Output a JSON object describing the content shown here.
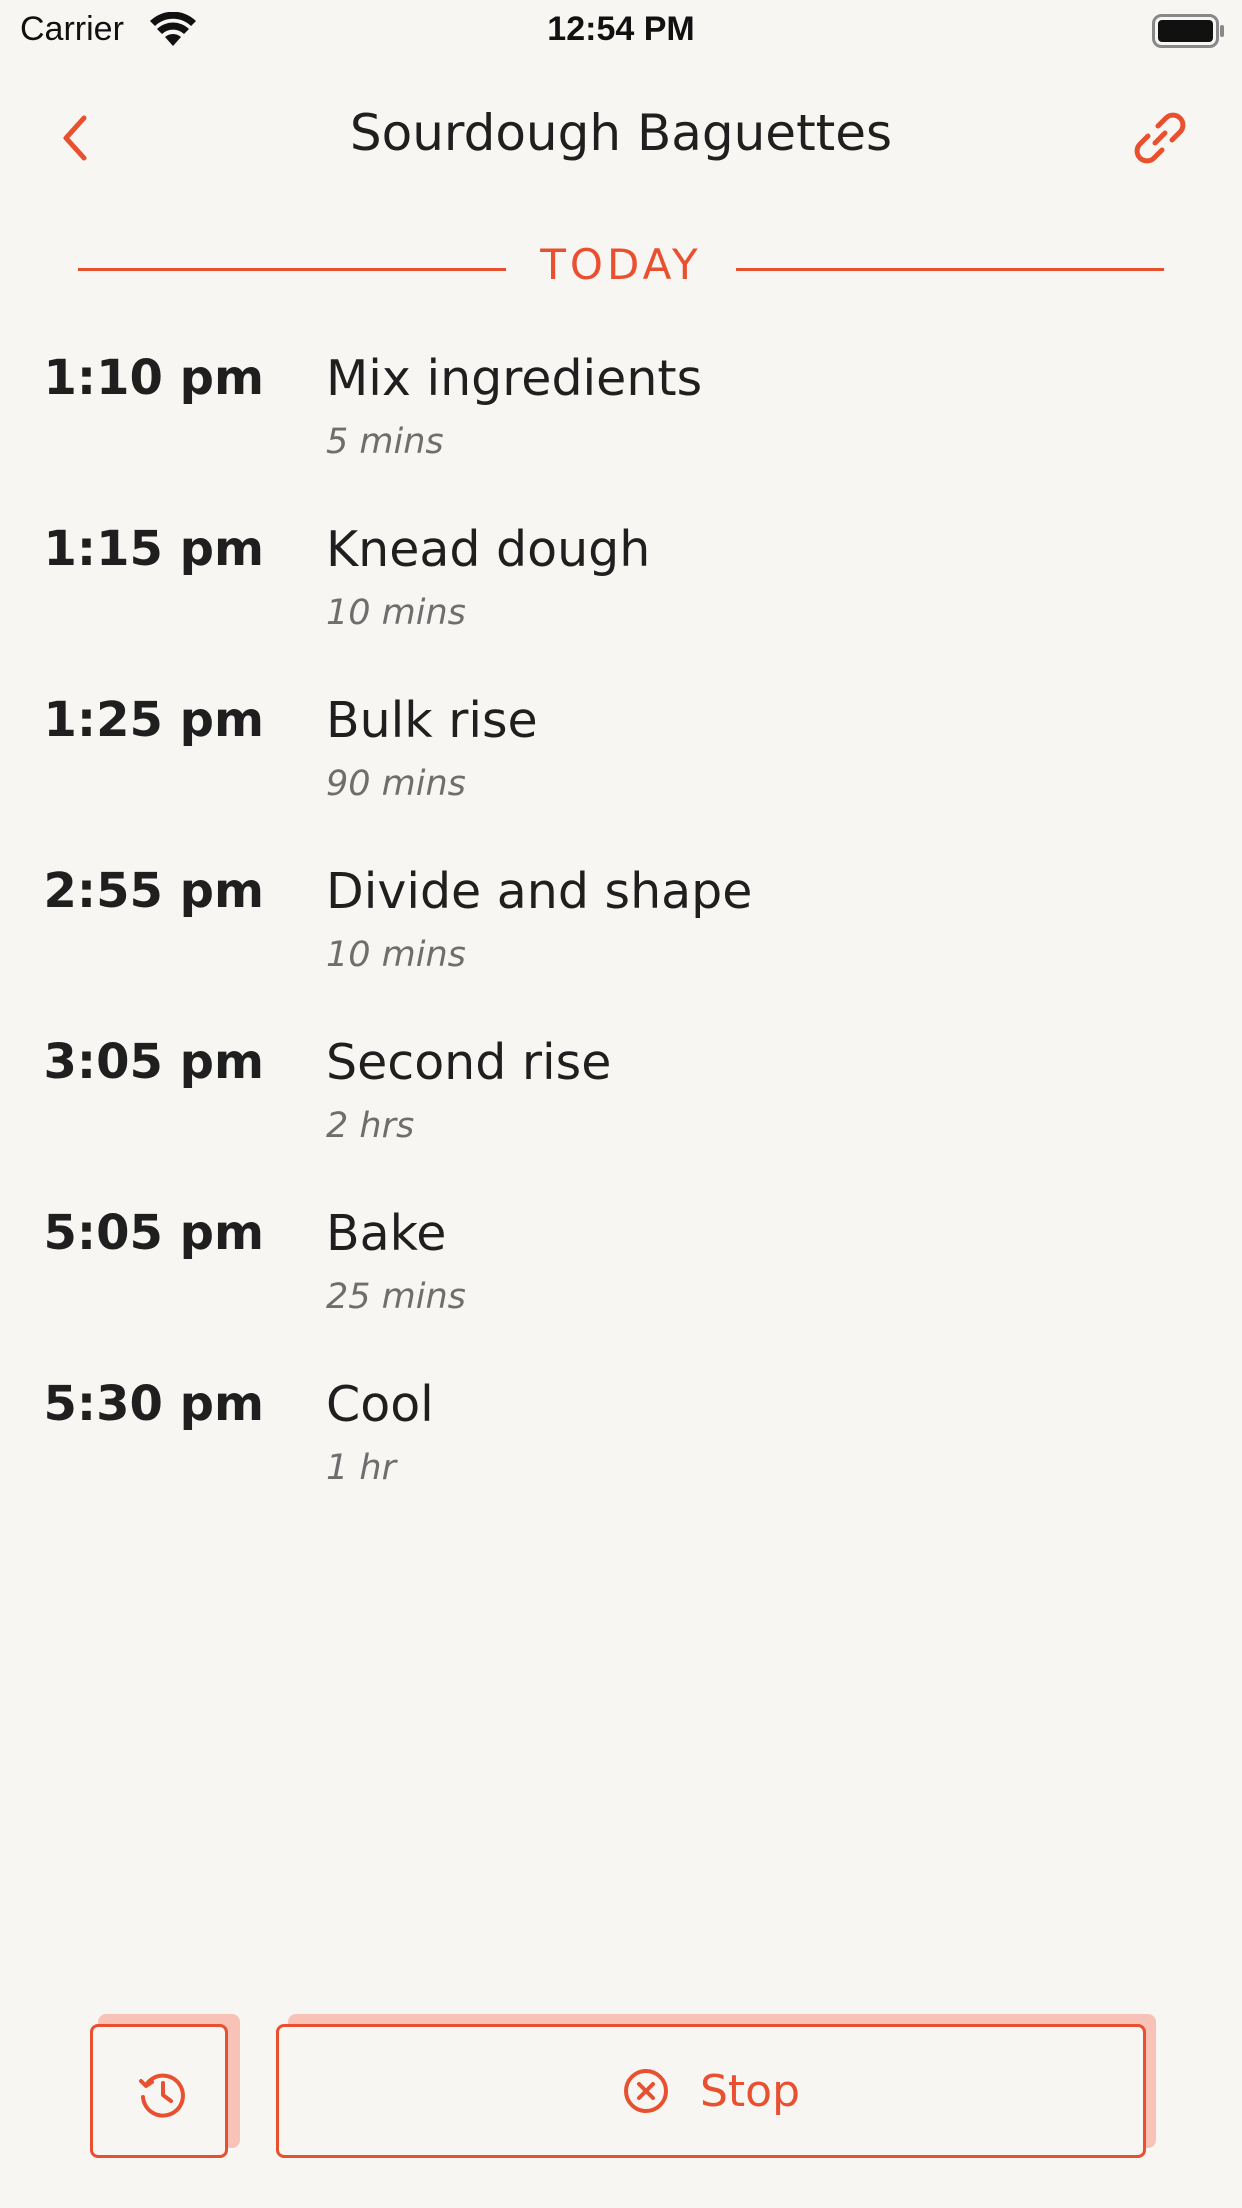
{
  "status_bar": {
    "carrier": "Carrier",
    "time": "12:54 PM"
  },
  "header": {
    "title": "Sourdough Baguettes",
    "back_icon": "chevron-left-icon",
    "link_icon": "link-icon"
  },
  "divider": {
    "label": "TODAY"
  },
  "steps": [
    {
      "time": "1:10 pm",
      "name": "Mix ingredients",
      "duration": "5 mins"
    },
    {
      "time": "1:15 pm",
      "name": "Knead dough",
      "duration": "10 mins"
    },
    {
      "time": "1:25 pm",
      "name": "Bulk rise",
      "duration": "90 mins"
    },
    {
      "time": "2:55 pm",
      "name": "Divide and shape",
      "duration": "10 mins"
    },
    {
      "time": "3:05 pm",
      "name": "Second rise",
      "duration": "2 hrs"
    },
    {
      "time": "5:05 pm",
      "name": "Bake",
      "duration": "25 mins"
    },
    {
      "time": "5:30 pm",
      "name": "Cool",
      "duration": "1 hr"
    }
  ],
  "actions": {
    "history_icon": "history-icon",
    "stop_label": "Stop",
    "stop_icon": "cancel-circle-icon"
  },
  "colors": {
    "accent": "#e8502f",
    "accent_shadow": "#f8c3b6",
    "background": "#f7f6f2",
    "text": "#1f1f1f",
    "secondary_text": "#6e6e6e"
  }
}
